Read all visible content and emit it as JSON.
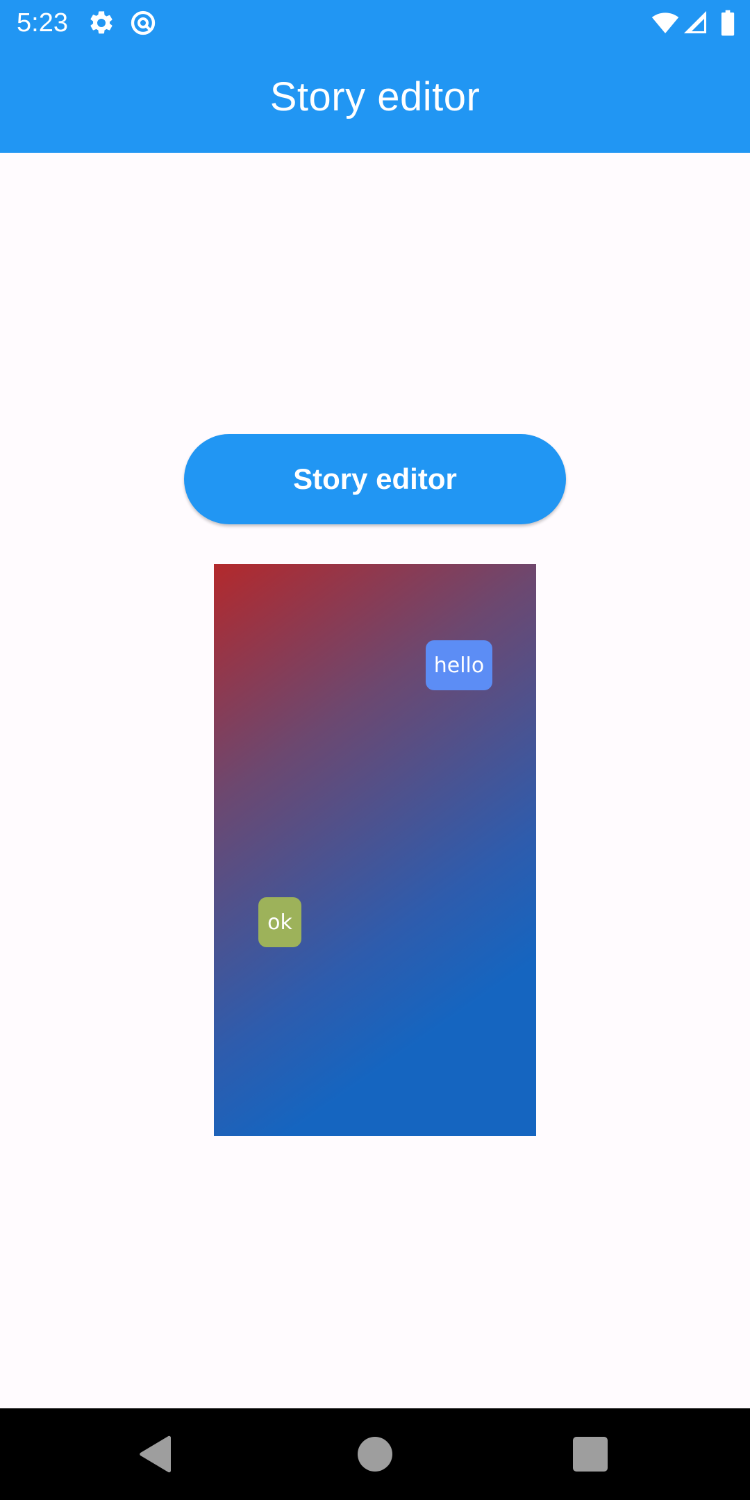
{
  "status_bar": {
    "time": "5:23",
    "icons": [
      "gear-icon",
      "data-saver-icon",
      "wifi-icon",
      "signal-icon",
      "battery-icon"
    ]
  },
  "app_bar": {
    "title": "Story editor",
    "background": "#2196f3"
  },
  "main": {
    "button_label": "Story editor",
    "button_color": "#2196f3",
    "canvas": {
      "gradient_colors": [
        "#b3292c",
        "#1565c0"
      ],
      "stickers": [
        {
          "text": "hello",
          "background": "#5c8df5"
        },
        {
          "text": "ok",
          "background": "#9db25a"
        }
      ]
    }
  },
  "nav_bar": {
    "icons": [
      "back-icon",
      "home-icon",
      "recents-icon"
    ]
  }
}
